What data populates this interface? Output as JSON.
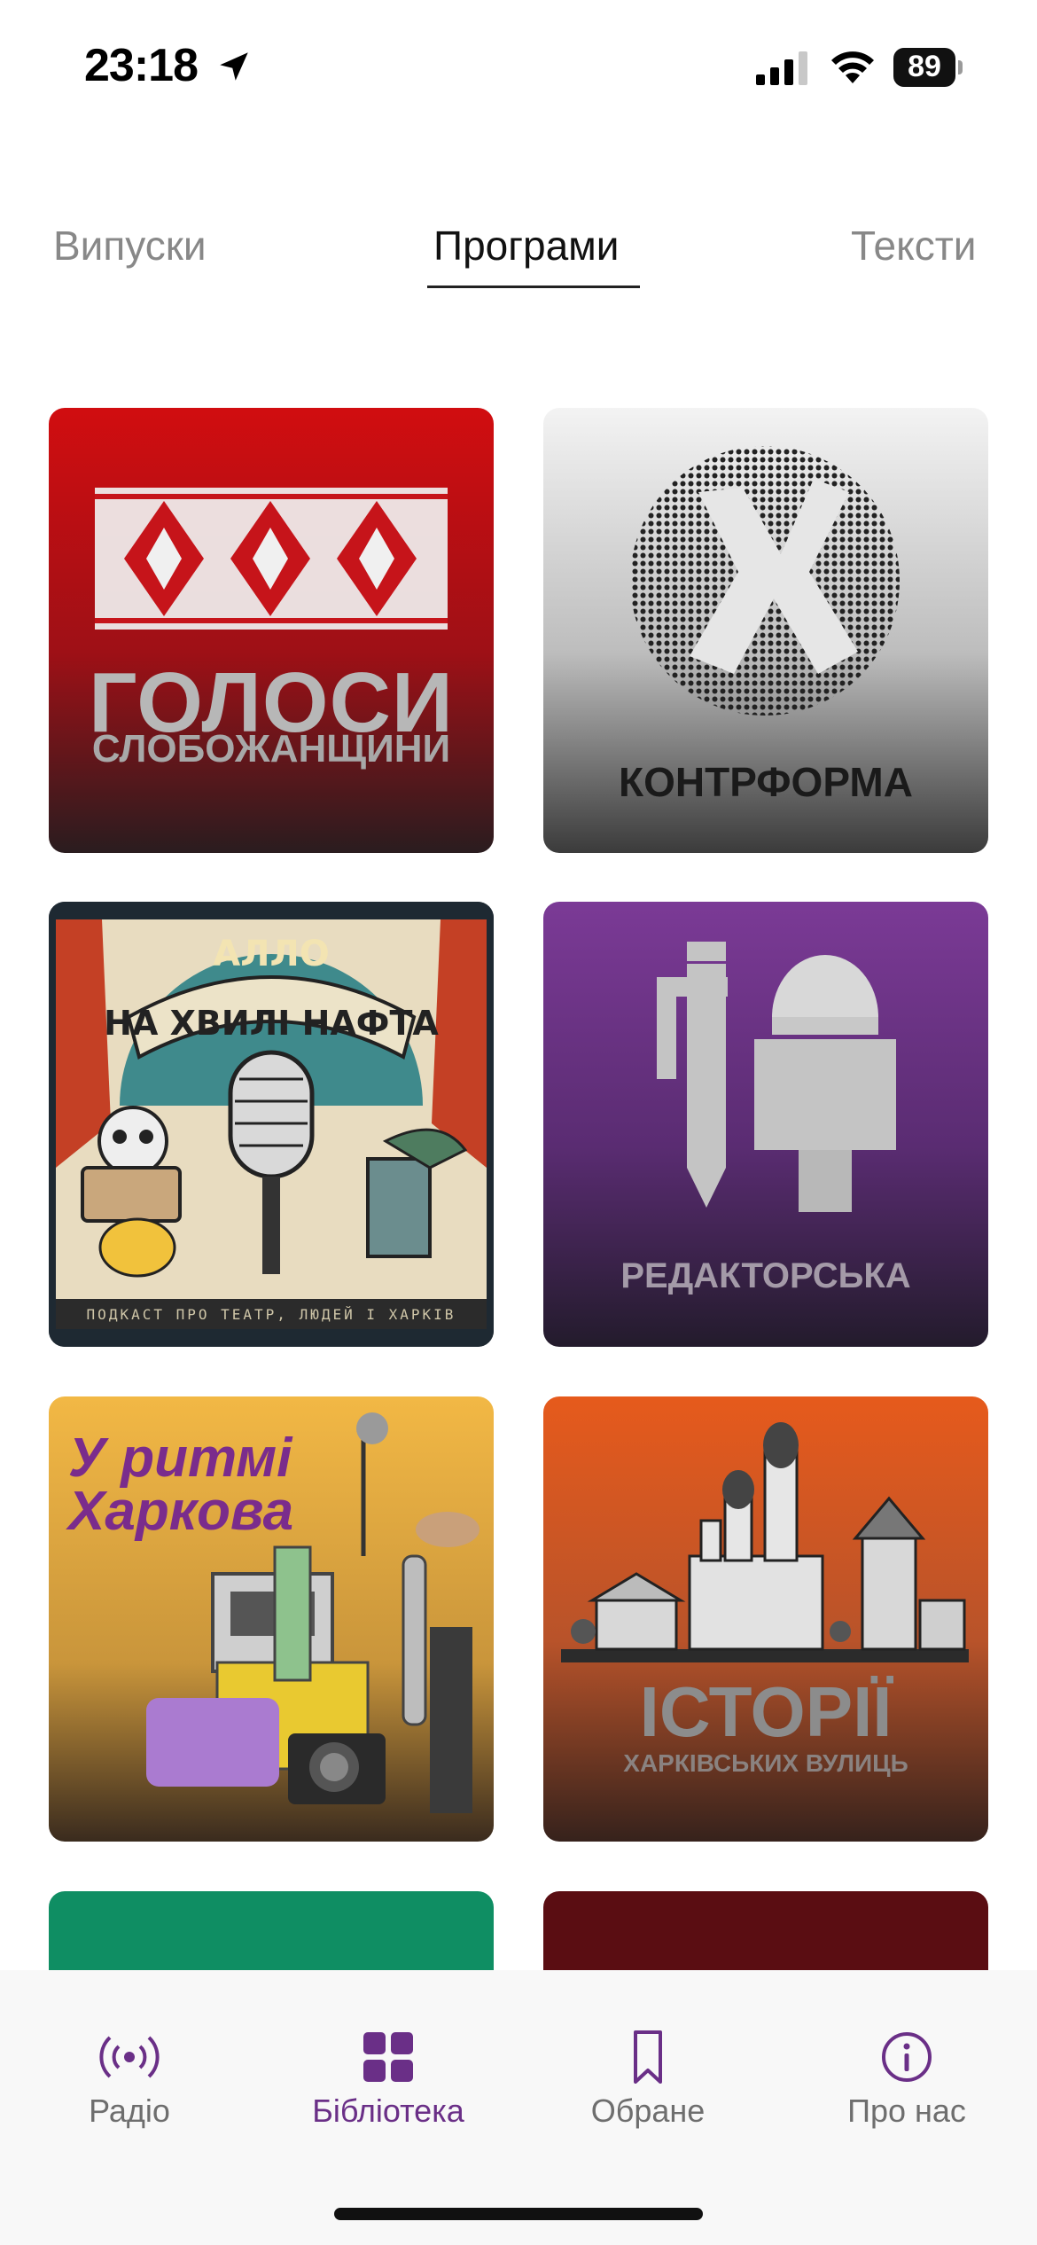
{
  "status_bar": {
    "time": "23:18",
    "battery": "89"
  },
  "tabs": [
    {
      "label": "Випуски",
      "active": false
    },
    {
      "label": "Програми",
      "active": true
    },
    {
      "label": "Тексти",
      "active": false
    }
  ],
  "programs": [
    {
      "title": "ГОЛОСИ",
      "subtitle": "СЛОБОЖАНЩИНИ"
    },
    {
      "title": "КОНТРФОРМА"
    },
    {
      "title": "АЛЛО",
      "subtitle": "НА ХВИЛІ НАФТА",
      "tagline": "ПОДКАСТ ПРО ТЕАТР, ЛЮДЕЙ І ХАРКІВ"
    },
    {
      "title": "РЕДАКТОРСЬКА"
    },
    {
      "title": "У ритмі\nХаркова"
    },
    {
      "title": "ІСТОРІЇ",
      "subtitle": "ХАРКІВСЬКИХ ВУЛИЦЬ"
    }
  ],
  "nav": [
    {
      "label": "Радіо",
      "icon": "radio-broadcast-icon",
      "active": false
    },
    {
      "label": "Бібліотека",
      "icon": "grid-icon",
      "active": true
    },
    {
      "label": "Обране",
      "icon": "bookmark-icon",
      "active": false
    },
    {
      "label": "Про нас",
      "icon": "info-icon",
      "active": false
    }
  ],
  "colors": {
    "accent": "#6a2f87",
    "background": "#ffffff"
  }
}
